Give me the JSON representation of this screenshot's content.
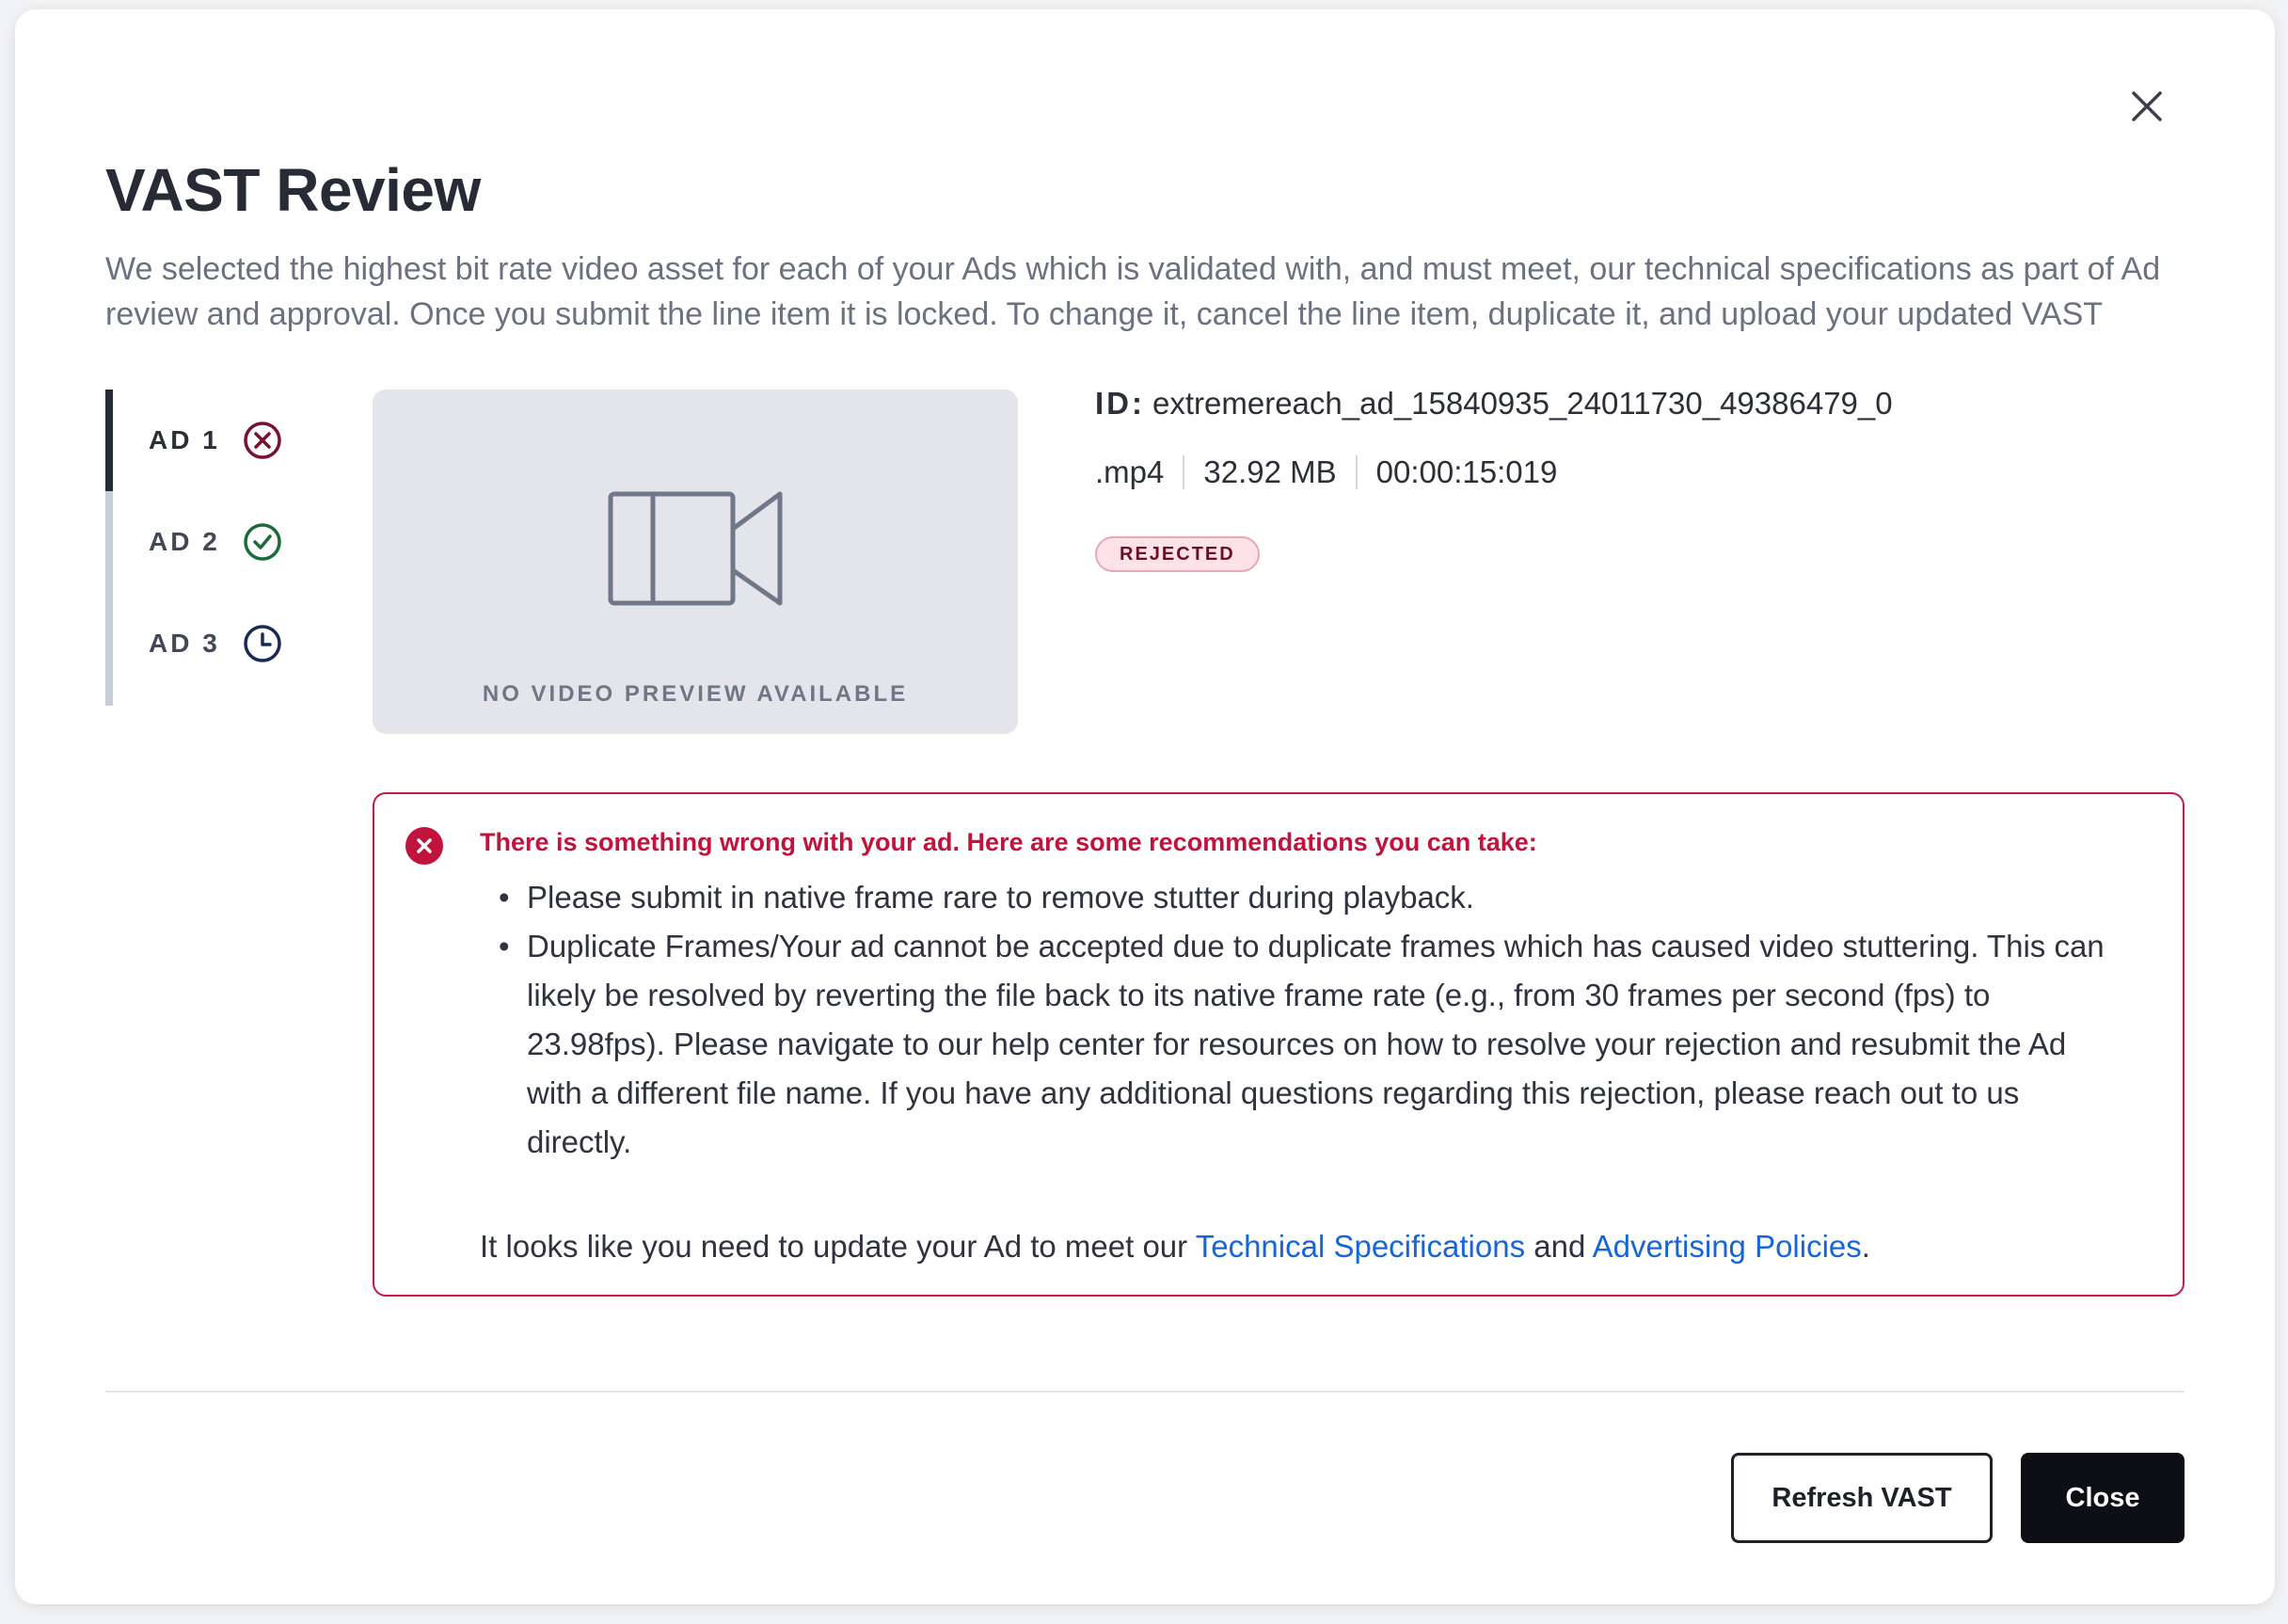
{
  "dialog": {
    "title": "VAST Review",
    "description": "We selected the highest bit rate video asset for each of your Ads which is validated with, and must meet, our technical specifications as part of Ad review and approval. Once you submit the line item it is locked. To change it, cancel the line item, duplicate it, and upload your updated VAST",
    "close_icon": "close-icon"
  },
  "ads": [
    {
      "label": "AD 1",
      "status": "rejected",
      "status_icon": "x-circle-icon",
      "status_color": "#7a1030"
    },
    {
      "label": "AD 2",
      "status": "approved",
      "status_icon": "check-circle-icon",
      "status_color": "#1c6b3a"
    },
    {
      "label": "AD 3",
      "status": "pending",
      "status_icon": "clock-icon",
      "status_color": "#1b2a55"
    }
  ],
  "preview": {
    "icon": "video-camera-icon",
    "label": "NO VIDEO PREVIEW AVAILABLE"
  },
  "asset": {
    "id_label": "ID:",
    "id_value": "extremereach_ad_15840935_24011730_49386479_0",
    "format": ".mp4",
    "size": "32.92 MB",
    "duration": "00:00:15:019",
    "status_badge": "REJECTED"
  },
  "alert": {
    "icon": "error-circle-icon",
    "heading": "There is something wrong with your ad. Here are some recommendations you can take:",
    "items": [
      "Please submit in native frame rare to remove stutter during playback.",
      "Duplicate Frames/Your ad cannot be accepted due to duplicate frames which has caused video stuttering. This can likely be resolved by reverting the file back to its native frame rate (e.g., from 30 frames per second (fps) to 23.98fps). Please navigate to our help center for resources on how to resolve your rejection and resubmit the Ad with a different file name. If you have any additional questions regarding this rejection, please reach out to us directly."
    ],
    "footer_prefix": "It looks like you need to update your Ad to meet our ",
    "link_tech": "Technical Specifications",
    "footer_and": " and ",
    "link_policies": "Advertising Policies",
    "footer_suffix": "."
  },
  "buttons": {
    "refresh": "Refresh VAST",
    "close": "Close"
  },
  "colors": {
    "error": "#c0143c",
    "link": "#1666d8",
    "primary_button": "#0d0f14"
  }
}
